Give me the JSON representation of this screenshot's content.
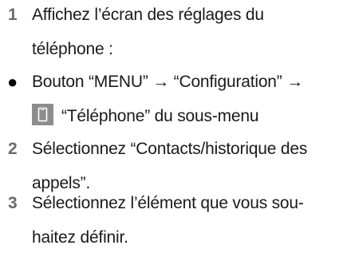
{
  "steps": [
    {
      "marker": "1",
      "lines": [
        "Affichez l’écran des réglages du",
        "téléphone :"
      ]
    },
    {
      "marker": "●",
      "line1": "Bouton “MENU” → “Configuration” →",
      "line2_text": "“Téléphone” du sous-menu",
      "icon": "phone-icon"
    },
    {
      "marker": "2",
      "lines": [
        "Sélectionnez “Contacts/historique des",
        "appels”."
      ]
    },
    {
      "marker": "3",
      "lines": [
        "Sélectionnez l’élément que vous sou-",
        "haitez définir."
      ]
    }
  ]
}
